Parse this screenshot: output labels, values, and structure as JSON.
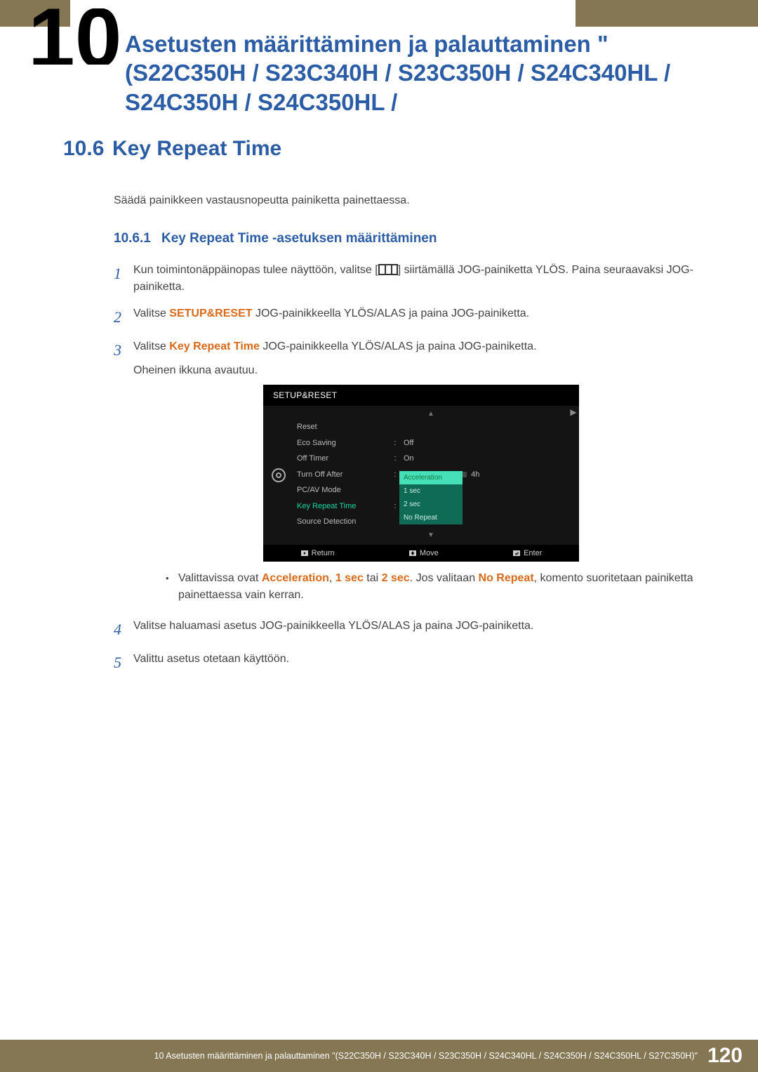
{
  "chapter_number_glyph": "10",
  "title_lines": "Asetusten määrittäminen ja palauttaminen \"(S22C350H / S23C340H / S23C350H / S24C340HL / S24C350H / S24C350HL /",
  "section": {
    "number": "10.6",
    "title": "Key Repeat Time",
    "intro": "Säädä painikkeen vastausnopeutta painiketta painettaessa."
  },
  "subsection": {
    "number": "10.6.1",
    "title": "Key Repeat Time -asetuksen määrittäminen"
  },
  "steps": {
    "s1a": "Kun toimintonäppäinopas tulee näyttöön, valitse [",
    "s1b": "] siirtämällä JOG-painiketta YLÖS. Paina seuraavaksi JOG-painiketta.",
    "s2a": "Valitse ",
    "s2hl": "SETUP&RESET",
    "s2b": " JOG-painikkeella YLÖS/ALAS ja paina JOG-painiketta.",
    "s3a": "Valitse ",
    "s3hl": "Key Repeat Time",
    "s3b": " JOG-painikkeella YLÖS/ALAS ja paina JOG-painiketta.",
    "s3c": "Oheinen ikkuna avautuu.",
    "s4": "Valitse haluamasi asetus JOG-painikkeella YLÖS/ALAS ja paina JOG-painiketta.",
    "s5": "Valittu asetus otetaan käyttöön."
  },
  "bullet": {
    "pre": "Valittavissa ovat ",
    "o1": "Acceleration",
    "sep1": ", ",
    "o2": "1 sec",
    "sep2": " tai ",
    "o3": "2 sec",
    "post1": ". Jos valitaan ",
    "o4": "No Repeat",
    "post2": ", komento suoritetaan painiketta painettaessa vain kerran."
  },
  "osd": {
    "title": "SETUP&RESET",
    "rows": {
      "reset": "Reset",
      "eco": "Eco Saving",
      "eco_val": "Off",
      "off_timer": "Off Timer",
      "off_timer_val": "On",
      "turn_off": "Turn Off After",
      "turn_off_val": "4h",
      "pcav": "PC/AV Mode",
      "krt": "Key Repeat Time",
      "src": "Source Detection"
    },
    "popup": {
      "p1": "Acceleration",
      "p2": "1 sec",
      "p3": "2 sec",
      "p4": "No Repeat"
    },
    "foot": {
      "return": "Return",
      "move": "Move",
      "enter": "Enter"
    }
  },
  "footer": {
    "breadcrumb": "10 Asetusten määrittäminen ja palauttaminen \"(S22C350H / S23C340H / S23C350H / S24C340HL / S24C350H / S24C350HL / S27C350H)\"",
    "page": "120"
  },
  "nums": {
    "n1": "1",
    "n2": "2",
    "n3": "3",
    "n4": "4",
    "n5": "5"
  }
}
